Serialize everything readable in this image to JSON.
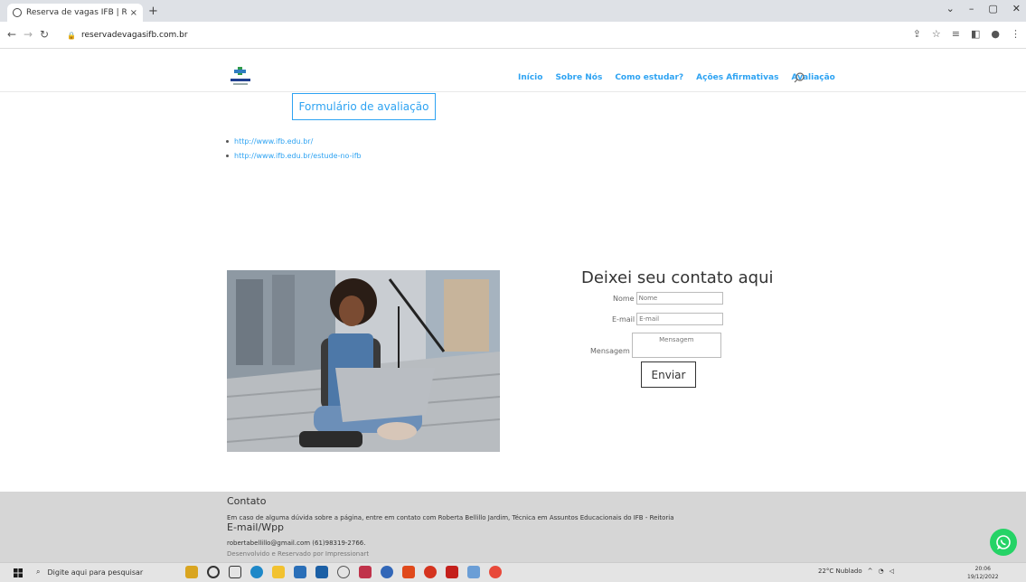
{
  "browser": {
    "tab_title": "Reserva de vagas IFB | Reser",
    "tab_close": "×",
    "new_tab": "+",
    "url": "reservadevagasifb.com.br",
    "window_controls": [
      "⌄",
      "–",
      "▢",
      "✕"
    ]
  },
  "site": {
    "nav": [
      "Início",
      "Sobre Nós",
      "Como estudar?",
      "Ações Afirmativas",
      "Avaliação"
    ],
    "form_button": "Formulário de avaliação",
    "links": [
      "http://www.ifb.edu.br/",
      "http://www.ifb.edu.br/estude-no-ifb"
    ]
  },
  "contact_form": {
    "title": "Deixei seu contato aqui",
    "name_label": "Nome",
    "name_placeholder": "Nome",
    "email_label": "E-mail",
    "email_placeholder": "E-mail",
    "message_label": "Mensagem",
    "message_placeholder": "Mensagem",
    "submit": "Enviar"
  },
  "footer": {
    "heading1": "Contato",
    "text1": "Em caso de alguma dúvida sobre a página, entre em contato com Roberta Bellillo Jardim, Técnica em Assuntos Educacionais do IFB - Reitoria",
    "heading2": "E-mail/Wpp",
    "text2": "robertabellillo@gmail.com (61)98319-2766.",
    "credit": "Desenvolvido e Reservado por Impressionart"
  },
  "taskbar": {
    "search_placeholder": "Digite aqui para pesquisar",
    "weather": "22°C  Nublado",
    "time": "20:06",
    "date": "19/12/2022"
  },
  "colors": {
    "accent": "#2ea3f2",
    "footer_bg": "#d6d6d6",
    "whatsapp": "#25d366"
  }
}
